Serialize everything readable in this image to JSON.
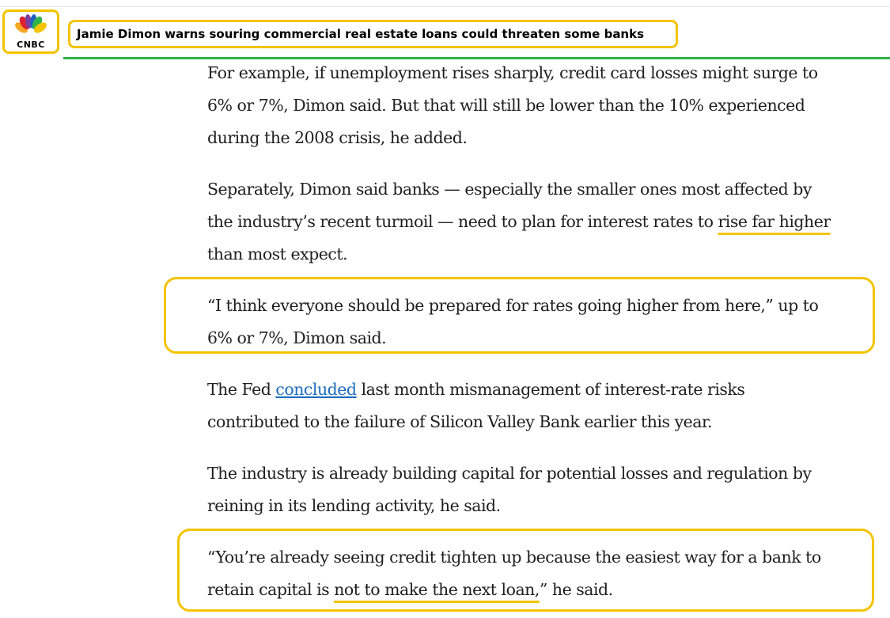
{
  "header": {
    "logo_text": "CNBC",
    "headline": "Jamie Dimon warns souring commercial real estate loans could threaten some banks"
  },
  "article": {
    "p1": {
      "line1": "For example, if unemployment rises sharply, credit card losses might surge to",
      "line2": "6% or 7%, Dimon said. But that will still be lower than the 10% experienced",
      "line3": "during the 2008 crisis, he added."
    },
    "p2": {
      "line1": "Separately, Dimon said banks — especially the smaller ones most affected by",
      "line2_pre": "the industry’s recent turmoil — need to plan for interest rates to ",
      "line2_mark": "rise far higher",
      "line3": "than most expect."
    },
    "p3": {
      "line1": "“I think everyone should be prepared for rates going higher from here,” up to",
      "line2": "6% or 7%, Dimon said."
    },
    "p4": {
      "line1_pre": "The Fed ",
      "link": "concluded",
      "line1_post": " last month mismanagement of interest-rate risks",
      "line2": "contributed to the failure of Silicon Valley Bank earlier this year."
    },
    "p5": {
      "line1": "The industry is already building capital for potential losses and regulation by",
      "line2": "reining in its lending activity, he said."
    },
    "p6": {
      "line1": "“You’re already seeing credit tighten up because the easiest way for a bank to",
      "line2_pre": "retain capital is ",
      "line2_mark": "not to make the next loan,",
      "line2_post": "” he said."
    }
  },
  "colors": {
    "annotation": "#f4c400",
    "brand_rule": "#2db34a",
    "link": "#1a6bbf"
  }
}
